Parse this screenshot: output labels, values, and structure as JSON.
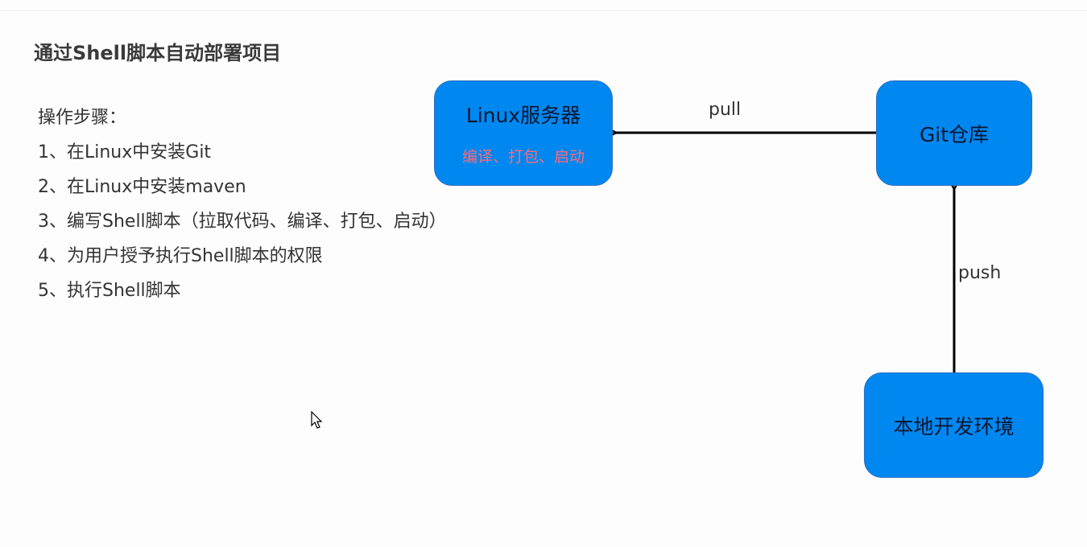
{
  "title": "通过Shell脚本自动部署项目",
  "steps": {
    "heading": "操作步骤：",
    "items": [
      "1、在Linux中安装Git",
      "2、在Linux中安装maven",
      "3、编写Shell脚本（拉取代码、编译、打包、启动）",
      "4、为用户授予执行Shell脚本的权限",
      "5、执行Shell脚本"
    ]
  },
  "diagram": {
    "linux_server": {
      "name": "Linux服务器",
      "sub": "编译、打包、启动"
    },
    "git_repo": {
      "name": "Git仓库"
    },
    "local_env": {
      "name": "本地开发环境"
    },
    "edges": {
      "pull": "pull",
      "push": "push"
    }
  },
  "colors": {
    "box_fill": "#0088f0",
    "sub_text": "#ff6a7a"
  }
}
